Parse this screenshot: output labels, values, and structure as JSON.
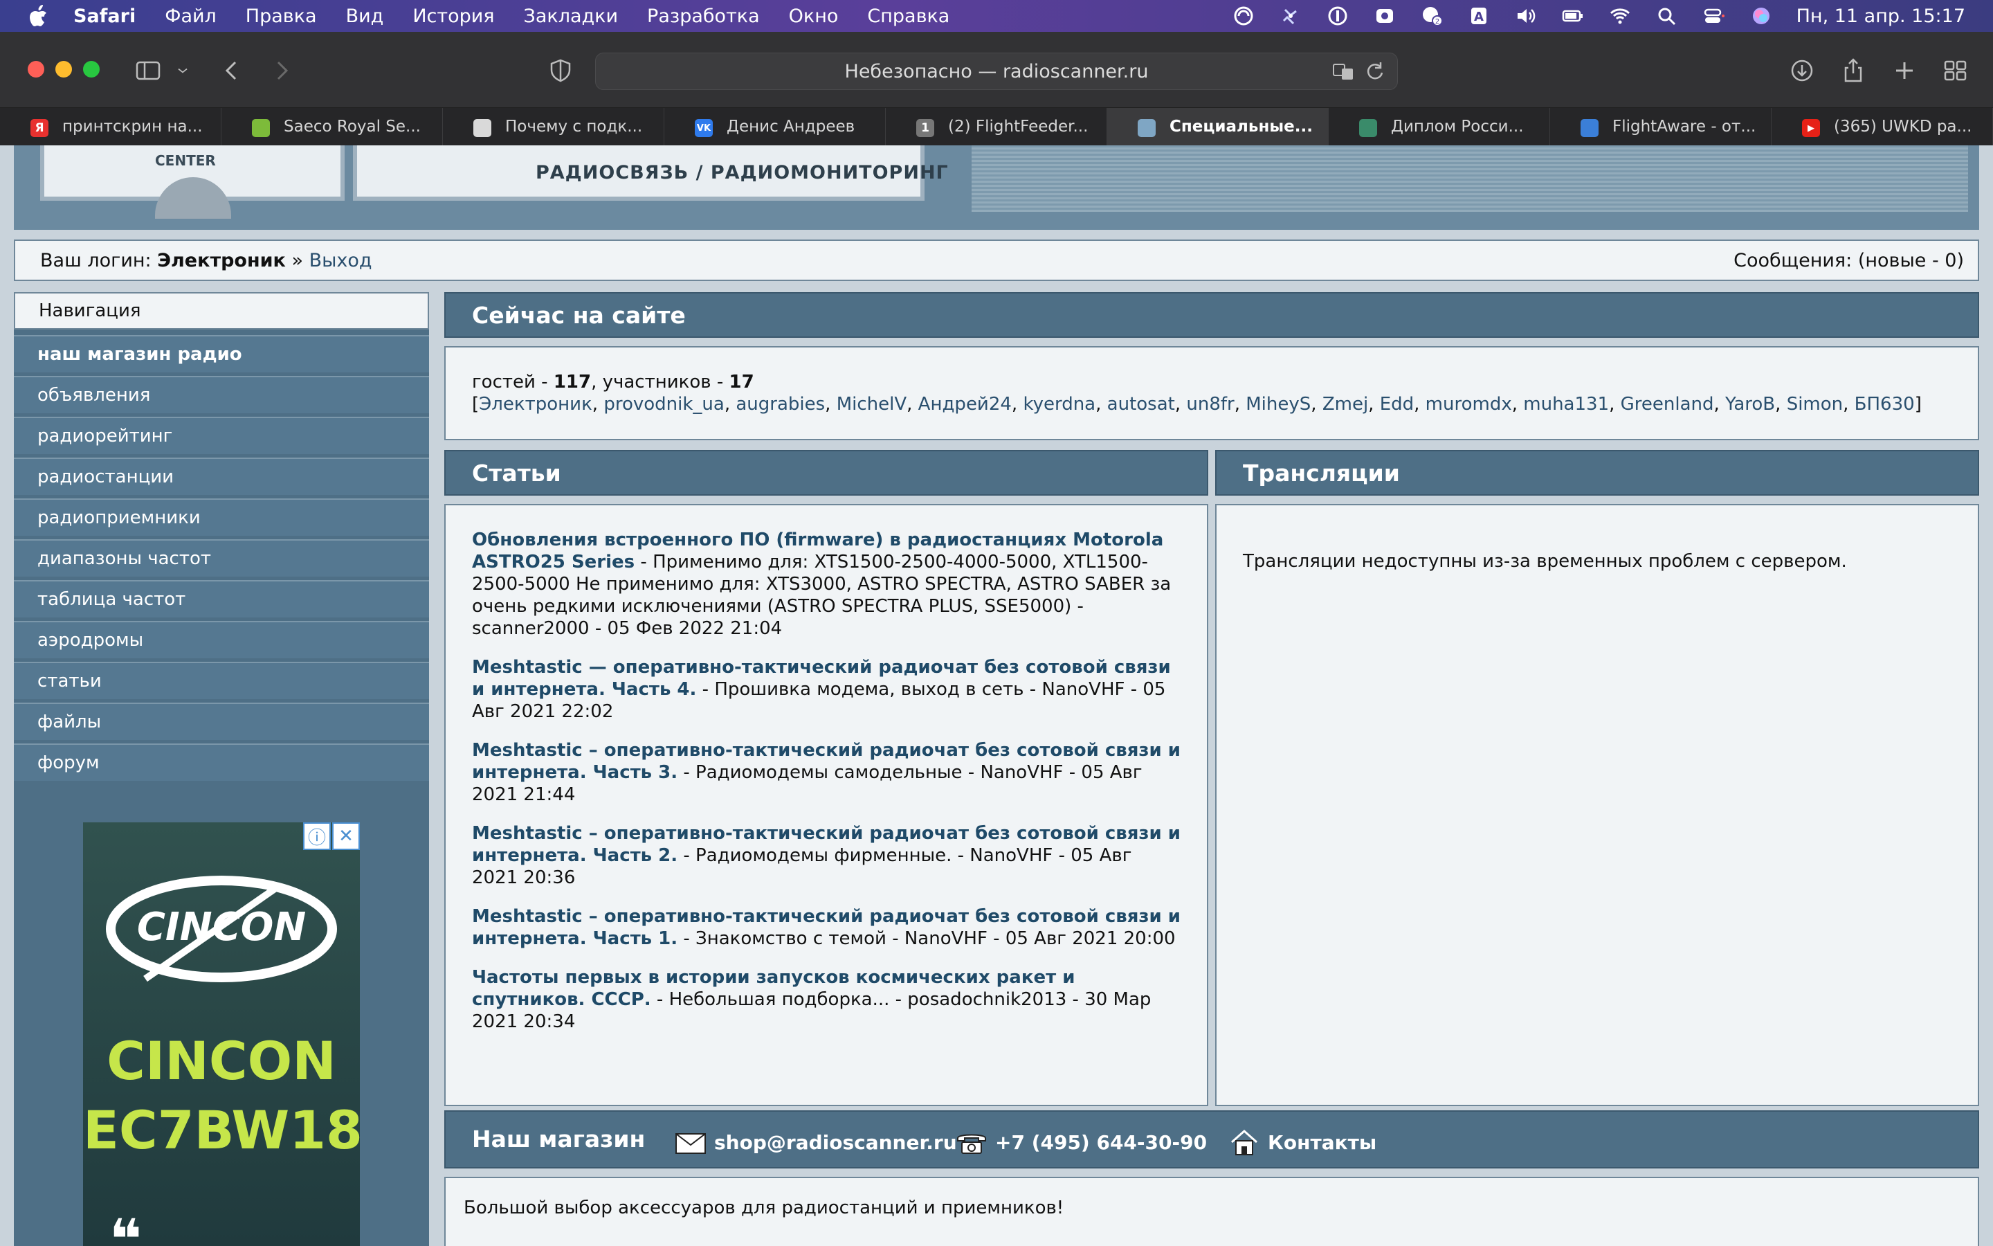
{
  "menubar": {
    "app": "Safari",
    "items": [
      "Файл",
      "Правка",
      "Вид",
      "История",
      "Закладки",
      "Разработка",
      "Окно",
      "Справка"
    ],
    "badge_count": "2",
    "input_letter": "A",
    "clock": "Пн, 11 апр.  15:17"
  },
  "browser": {
    "address": "Небезопасно — radioscanner.ru",
    "tabs": [
      {
        "label": "принтскрин на...",
        "favicon": "Я",
        "color": "#e8312f"
      },
      {
        "label": "Saeco Royal Se...",
        "favicon": "",
        "color": "#7dbb3a"
      },
      {
        "label": "Почему с подк...",
        "favicon": "",
        "color": "#d9d9d9"
      },
      {
        "label": "Денис Андреев",
        "favicon": "VK",
        "color": "#2f7bed"
      },
      {
        "label": "(2) FlightFeeder...",
        "favicon": "1",
        "color": "#777777"
      },
      {
        "label": "Специальные...",
        "favicon": "",
        "color": "#7fa6c4"
      },
      {
        "label": "Диплом Росси...",
        "favicon": "",
        "color": "#3a8b6a"
      },
      {
        "label": "FlightAware - от...",
        "favicon": "",
        "color": "#3b7fd8"
      },
      {
        "label": "(365) UWKD ра...",
        "favicon": "▶",
        "color": "#e62117"
      }
    ]
  },
  "banner": {
    "meter_label": "CENTER",
    "logo_sub": "РАДИОСВЯЗЬ / РАДИОМОНИТОРИНГ"
  },
  "login": {
    "prefix": "Ваш логин:",
    "user": "Электроник",
    "separator": "»",
    "logout": "Выход",
    "messages": "Сообщения: (новые - 0)"
  },
  "nav": {
    "header": "Навигация",
    "items": [
      "наш магазин радио",
      "объявления",
      "радиорейтинг",
      "радиостанции",
      "радиоприемники",
      "диапазоны частот",
      "таблица частот",
      "аэродромы",
      "статьи",
      "файлы",
      "форум"
    ]
  },
  "ad": {
    "logo_text": "CINCON",
    "brand": "CINCON",
    "model": "EC7BW18",
    "quote": "❝"
  },
  "online": {
    "title": "Сейчас на сайте",
    "guests_label": "гостей - ",
    "guests": "117",
    "members_label": ", участников - ",
    "members": "17",
    "users": [
      "Электроник",
      "provodnik_ua",
      "augrabies",
      "MichelV",
      "Андрей24",
      "kyerdna",
      "autosat",
      "un8fr",
      "MiheyS",
      "Zmej",
      "Edd",
      "muromdx",
      "muha131",
      "Greenland",
      "YaroB",
      "Simon",
      "БП630"
    ]
  },
  "articles": {
    "title": "Статьи",
    "items": [
      {
        "title": "Обновления встроенного ПО (firmware) в радиостанциях Motorola ASTRO25 Series",
        "desc": " - Применимо для: XTS1500-2500-4000-5000, XTL1500-2500-5000 Не применимо для: XTS3000, ASTRO SPECTRA, ASTRO SABER за очень редкими исключениями (ASTRO SPECTRA PLUS, SSE5000) - scanner2000 - 05 Фев 2022 21:04"
      },
      {
        "title": "Meshtastic — оперативно-тактический радиочат без сотовой связи и интернета. Часть 4.",
        "desc": " - Прошивка модема, выход в сеть - NanoVHF - 05 Авг 2021 22:02"
      },
      {
        "title": "Meshtastic – оперативно-тактический радиочат без сотовой связи и интернета. Часть 3.",
        "desc": " - Радиомодемы самодельные - NanoVHF - 05 Авг 2021 21:44"
      },
      {
        "title": "Meshtastic – оперативно-тактический радиочат без сотовой связи и интернета. Часть 2.",
        "desc": " - Радиомодемы фирменные. - NanoVHF - 05 Авг 2021 20:36"
      },
      {
        "title": "Meshtastic – оперативно-тактический радиочат без сотовой связи и интернета. Часть 1.",
        "desc": " - Знакомство с темой - NanoVHF - 05 Авг 2021 20:00"
      },
      {
        "title": "Частоты первых в истории запусков космических ракет и спутников. СССР.",
        "desc": " - Небольшая подборка... - posadochnik2013 - 30 Мар 2021 20:34"
      }
    ]
  },
  "streams": {
    "title": "Трансляции",
    "message": "Трансляции недоступны из-за временных проблем с сервером."
  },
  "shop": {
    "title": "Наш магазин",
    "email": "shop@radioscanner.ru",
    "phone": "+7 (495) 644-30-90",
    "contacts": "Контакты",
    "body": "Большой выбор аксессуаров для радиостанций и приемников!"
  }
}
